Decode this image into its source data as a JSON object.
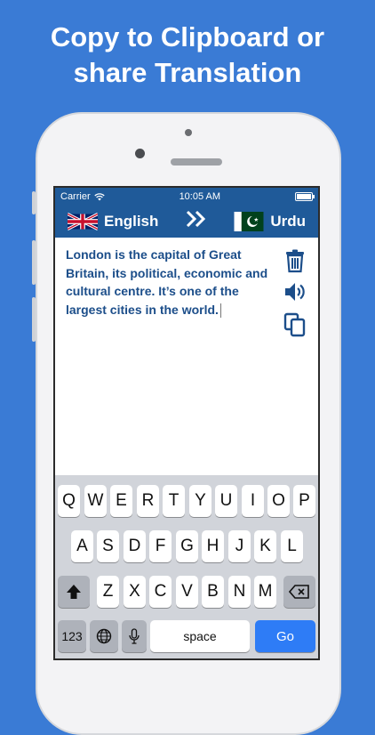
{
  "headline": {
    "line1": "Copy to Clipboard or",
    "line2": "share Translation"
  },
  "status": {
    "carrier": "Carrier",
    "time": "10:05 AM"
  },
  "languages": {
    "source": "English",
    "target": "Urdu",
    "swap_icon": "double-chevron-right-icon"
  },
  "text": {
    "content": "London is the capital of Great Britain, its political, economic and cultural centre. It’s one of the largest cities in the world."
  },
  "tools": [
    "trash-icon",
    "speaker-icon",
    "copy-icon"
  ],
  "keyboard": {
    "row1": [
      "Q",
      "W",
      "E",
      "R",
      "T",
      "Y",
      "U",
      "I",
      "O",
      "P"
    ],
    "row2": [
      "A",
      "S",
      "D",
      "F",
      "G",
      "H",
      "J",
      "K",
      "L"
    ],
    "row3": [
      "Z",
      "X",
      "C",
      "V",
      "B",
      "N",
      "M"
    ],
    "num_label": "123",
    "space_label": "space",
    "go_label": "Go"
  },
  "colors": {
    "background": "#3a7bd5",
    "bar": "#1f5a99",
    "text": "#1c4e8a",
    "go": "#2e7cf6"
  }
}
